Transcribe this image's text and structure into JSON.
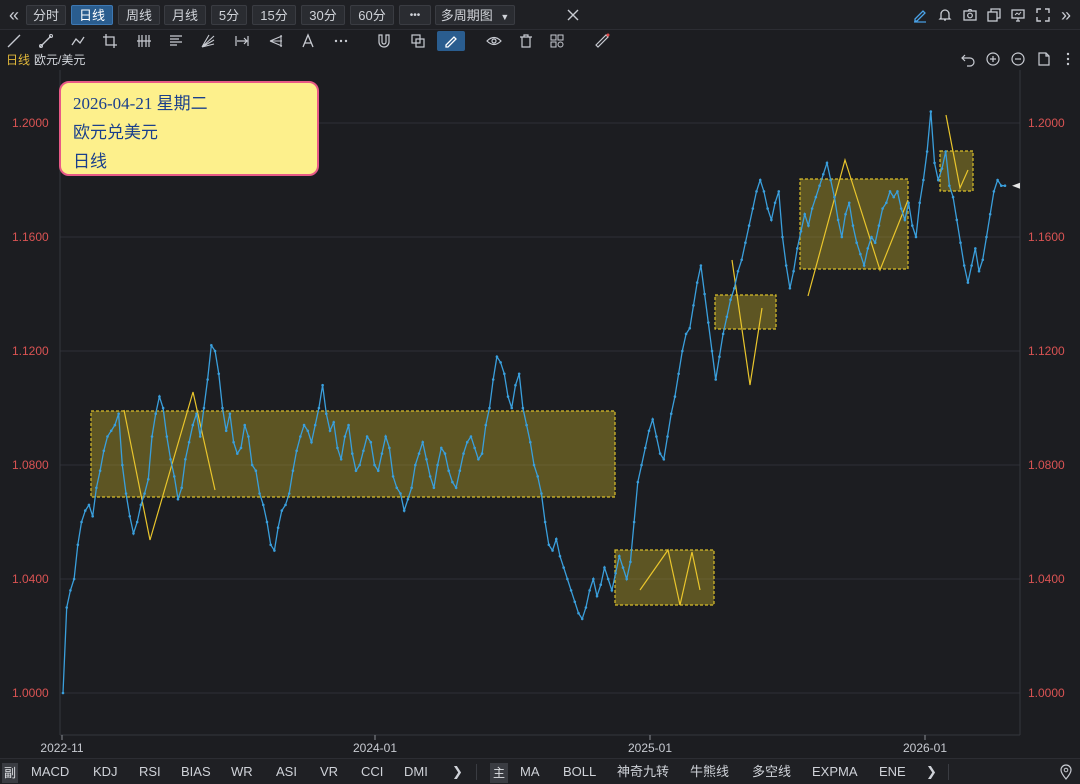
{
  "periods": {
    "back": "«",
    "items": [
      "分时",
      "日线",
      "周线",
      "月线",
      "5分",
      "15分",
      "30分",
      "60分"
    ],
    "active_index": 1,
    "more": "•••",
    "multi": "多周期图",
    "forward": "»"
  },
  "chart_header": {
    "period": "日线",
    "symbol": "欧元/美元"
  },
  "tooltip": {
    "date": "2026-04-21 星期二",
    "name": "欧元兑美元",
    "period": "日线"
  },
  "chart_data": {
    "type": "line",
    "ylim": [
      0.996,
      1.212
    ],
    "y_ticks": [
      "1.0000",
      "1.0400",
      "1.0800",
      "1.1200",
      "1.1600",
      "1.2000"
    ],
    "y_tick_values": [
      1.0,
      1.04,
      1.08,
      1.12,
      1.16,
      1.2
    ],
    "x_ticks": [
      "2022-11",
      "2024-01",
      "2025-01",
      "2026-01"
    ],
    "series": [
      {
        "color": "#3a9fdc",
        "values": [
          1.0,
          1.03,
          1.036,
          1.04,
          1.052,
          1.06,
          1.064,
          1.066,
          1.062,
          1.072,
          1.078,
          1.085,
          1.09,
          1.092,
          1.094,
          1.098,
          1.08,
          1.07,
          1.062,
          1.056,
          1.06,
          1.066,
          1.07,
          1.075,
          1.09,
          1.098,
          1.104,
          1.1,
          1.09,
          1.082,
          1.076,
          1.068,
          1.072,
          1.082,
          1.088,
          1.094,
          1.098,
          1.09,
          1.1,
          1.11,
          1.122,
          1.12,
          1.112,
          1.1,
          1.092,
          1.098,
          1.088,
          1.084,
          1.086,
          1.094,
          1.09,
          1.08,
          1.078,
          1.07,
          1.066,
          1.06,
          1.052,
          1.05,
          1.058,
          1.064,
          1.066,
          1.07,
          1.078,
          1.085,
          1.09,
          1.094,
          1.092,
          1.088,
          1.094,
          1.1,
          1.108,
          1.098,
          1.092,
          1.095,
          1.086,
          1.082,
          1.09,
          1.094,
          1.084,
          1.078,
          1.08,
          1.085,
          1.09,
          1.088,
          1.08,
          1.078,
          1.084,
          1.09,
          1.086,
          1.076,
          1.072,
          1.07,
          1.064,
          1.068,
          1.072,
          1.08,
          1.084,
          1.088,
          1.082,
          1.076,
          1.072,
          1.08,
          1.086,
          1.084,
          1.078,
          1.074,
          1.072,
          1.078,
          1.084,
          1.088,
          1.09,
          1.086,
          1.082,
          1.084,
          1.094,
          1.1,
          1.11,
          1.118,
          1.116,
          1.112,
          1.104,
          1.1,
          1.108,
          1.112,
          1.1,
          1.094,
          1.088,
          1.08,
          1.076,
          1.07,
          1.06,
          1.052,
          1.05,
          1.054,
          1.048,
          1.044,
          1.04,
          1.036,
          1.032,
          1.028,
          1.026,
          1.03,
          1.036,
          1.04,
          1.034,
          1.038,
          1.044,
          1.04,
          1.036,
          1.042,
          1.048,
          1.044,
          1.04,
          1.046,
          1.06,
          1.074,
          1.08,
          1.086,
          1.092,
          1.096,
          1.09,
          1.084,
          1.082,
          1.09,
          1.098,
          1.104,
          1.112,
          1.12,
          1.126,
          1.128,
          1.136,
          1.144,
          1.15,
          1.14,
          1.13,
          1.12,
          1.11,
          1.118,
          1.126,
          1.132,
          1.138,
          1.142,
          1.148,
          1.152,
          1.158,
          1.164,
          1.17,
          1.176,
          1.18,
          1.176,
          1.17,
          1.166,
          1.172,
          1.176,
          1.16,
          1.15,
          1.142,
          1.148,
          1.156,
          1.162,
          1.168,
          1.164,
          1.17,
          1.174,
          1.178,
          1.182,
          1.186,
          1.18,
          1.174,
          1.166,
          1.16,
          1.168,
          1.172,
          1.164,
          1.158,
          1.154,
          1.15,
          1.156,
          1.16,
          1.158,
          1.164,
          1.17,
          1.172,
          1.176,
          1.174,
          1.176,
          1.17,
          1.166,
          1.172,
          1.164,
          1.16,
          1.172,
          1.18,
          1.19,
          1.204,
          1.186,
          1.18,
          1.184,
          1.19,
          1.178,
          1.174,
          1.166,
          1.158,
          1.15,
          1.144,
          1.15,
          1.156,
          1.148,
          1.152,
          1.16,
          1.168,
          1.176,
          1.18,
          1.178,
          1.178
        ]
      }
    ]
  },
  "boxes": [
    "box-consolidation-2023-2024",
    "box-2025-01",
    "box-2025-04",
    "box-2025-mid",
    "box-2026-01"
  ],
  "indicators": [
    "MACD",
    "KDJ",
    "RSI",
    "BIAS",
    "WR",
    "ASI",
    "VR",
    "CCI",
    "DMI"
  ],
  "indicator_prefix": "副",
  "overlays_prefix": "主",
  "overlays": [
    "MA",
    "BOLL",
    "神奇九转",
    "牛熊线",
    "多空线",
    "EXPMA",
    "ENE"
  ],
  "more_arrow": "❯"
}
